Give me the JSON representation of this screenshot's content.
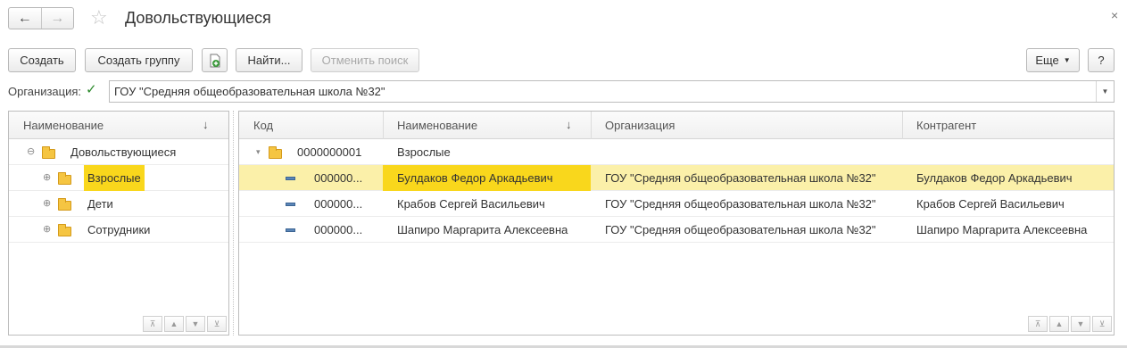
{
  "window": {
    "title": "Довольствующиеся",
    "back_icon": "←",
    "forward_icon": "→",
    "star_icon": "☆",
    "close_icon": "×"
  },
  "toolbar": {
    "create": "Создать",
    "create_group": "Создать группу",
    "find": "Найти...",
    "cancel_search": "Отменить поиск",
    "more": "Еще",
    "help": "?"
  },
  "filter": {
    "label": "Организация:",
    "checked": "✓",
    "value": "ГОУ \"Средняя общеобразовательная школа №32\""
  },
  "tree": {
    "header": "Наименование",
    "sort_icon": "↓",
    "nodes": [
      {
        "label": "Довольствующиеся",
        "expander": "⊖"
      },
      {
        "label": "Взрослые",
        "expander": "⊕"
      },
      {
        "label": "Дети",
        "expander": "⊕"
      },
      {
        "label": "Сотрудники",
        "expander": "⊕"
      }
    ]
  },
  "list": {
    "columns": [
      "Код",
      "Наименование",
      "Организация",
      "Контрагент"
    ],
    "sort_icon": "↓",
    "group_row": {
      "code": "0000000001",
      "name": "Взрослые",
      "expander": "▾"
    },
    "rows": [
      {
        "code": "000000...",
        "name": "Булдаков Федор Аркадьевич",
        "org": "ГОУ \"Средняя общеобразовательная школа №32\"",
        "counterparty": "Булдаков Федор Аркадьевич"
      },
      {
        "code": "000000...",
        "name": "Крабов Сергей Васильевич",
        "org": "ГОУ \"Средняя общеобразовательная школа №32\"",
        "counterparty": "Крабов Сергей Васильевич"
      },
      {
        "code": "000000...",
        "name": "Шапиро Маргарита Алексеевна",
        "org": "ГОУ \"Средняя общеобразовательная школа №32\"",
        "counterparty": "Шапиро Маргарита Алексеевна"
      }
    ]
  },
  "scroll_nav": {
    "first": "⊼",
    "up": "▲",
    "down": "▼",
    "last": "⊻"
  },
  "colors": {
    "selected_row": "#fbf0a9",
    "current_cell": "#f9d71c",
    "accent_green": "#2c8a2c"
  }
}
